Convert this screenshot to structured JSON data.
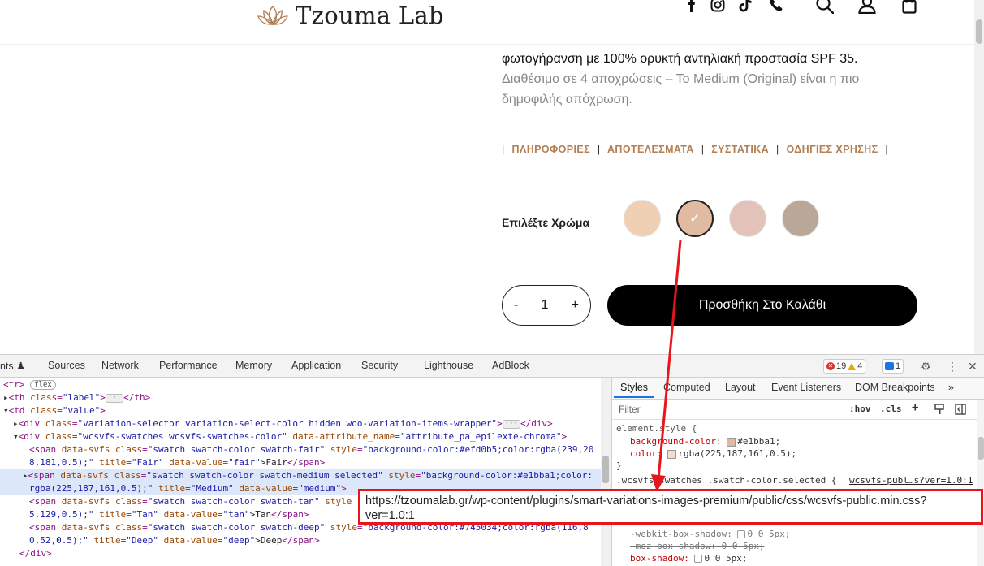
{
  "site": {
    "logo_text": "Tzouma Lab",
    "description_line1": "φωτογήρανση με 100% ορυκτή αντηλιακή προστασία SPF 35.",
    "description_line2": "Διαθέσιμο σε 4 αποχρώσεις – Το Medium (Original) είναι η πιο",
    "description_line3": "δημοφιλής απόχρωση.",
    "tabs": [
      "ΠΛΗΡΟΦΟΡΙΕΣ",
      "ΑΠΟΤΕΛΕΣΜΑΤΑ",
      "ΣΥΣΤΑΤΙΚΑ",
      "ΟΔΗΓΙΕΣ ΧΡΗΣΗΣ"
    ],
    "tab_separator": "|",
    "color_label": "Επιλέξτε Χρώμα",
    "swatches": [
      {
        "color": "#efd0b5",
        "selected": false
      },
      {
        "color": "#e1bba1",
        "selected": true
      },
      {
        "color": "#e3c2b9",
        "selected": false
      },
      {
        "color": "#b9a898",
        "selected": false
      }
    ],
    "check_glyph": "✓",
    "qty_minus": "-",
    "qty_value": "1",
    "qty_plus": "+",
    "add_to_cart": "Προσθήκη Στο Καλάθι",
    "header_icons": [
      "facebook-icon",
      "instagram-icon",
      "tiktok-icon",
      "phone-icon",
      "search-icon",
      "user-icon",
      "bag-icon"
    ]
  },
  "devtools": {
    "tabs": [
      "nts",
      "Sources",
      "Network",
      "Performance",
      "Memory",
      "Application",
      "Security",
      "Lighthouse",
      "AdBlock"
    ],
    "errors": "19",
    "warnings": "4",
    "infos": "1",
    "elements": {
      "l0_tag": "<tr>",
      "l0_badge": "flex",
      "l1_open": "<th ",
      "l1_attr": "class",
      "l1_val": "\"label\"",
      "l1_close": "</th>",
      "l2_open": "<td ",
      "l2_attr": "class",
      "l2_val": "\"value\"",
      "l3_open": "<div ",
      "l3_attr": "class",
      "l3_val": "\"variation-selector variation-select-color hidden woo-variation-items-wrapper\"",
      "l3_close": "</div>",
      "l4_open": "<div ",
      "l4_attr1": "class",
      "l4_val1": "\"wcsvfs-swatches wcsvfs-swatches-color\"",
      "l4_attr2": "data-attribute_name",
      "l4_val2": "\"attribute_pa_epilexte-chroma\"",
      "l5_a": "<span ",
      "l5_b": "data-svfs ",
      "l5_c": "class",
      "l5_d": "\"swatch swatch-color swatch-fair\" ",
      "l5_e": "style",
      "l5_f": "\"background-color:#efd0b5;color:rgba(239,20",
      "l6_a": "8,181,0.5);\" ",
      "l6_b": "title",
      "l6_c": "\"Fair\" ",
      "l6_d": "data-value",
      "l6_e": "\"fair\"",
      "l6_f": ">Fair",
      "l6_g": "</span>",
      "l7_a": "<span ",
      "l7_b": "data-svfs ",
      "l7_c": "class",
      "l7_d": "\"swatch swatch-color swatch-medium selected\" ",
      "l7_e": "style",
      "l7_f": "\"background-color:#e1bba1;color:",
      "l8_a": "rgba(225,187,161,0.5);\" ",
      "l8_b": "title",
      "l8_c": "\"Medium\" ",
      "l8_d": "data-value",
      "l8_e": "\"medium\"",
      "l8_f": ">",
      "l9_a": "<span ",
      "l9_b": "data-svfs ",
      "l9_c": "class",
      "l9_d": "\"swatch swatch-color swatch-tan\" ",
      "l9_e": "style",
      "l10_a": "5,129,0.5);\" ",
      "l10_b": "title",
      "l10_c": "\"Tan\" ",
      "l10_d": "data-value",
      "l10_e": "\"tan\"",
      "l10_f": ">Tan",
      "l10_g": "</span>",
      "l11_a": "<span ",
      "l11_b": "data-svfs ",
      "l11_c": "class",
      "l11_d": "\"swatch swatch-color swatch-deep\" ",
      "l11_e": "style",
      "l11_f": "\"background-color:#745034;color:rgba(116,8",
      "l12_a": "0,52,0.5);\" ",
      "l12_b": "title",
      "l12_c": "\"Deep\" ",
      "l12_d": "data-value",
      "l12_e": "\"deep\"",
      "l12_f": ">Deep",
      "l12_g": "</span>",
      "l13": "</div>",
      "equals": "="
    },
    "styles": {
      "tabs": [
        "Styles",
        "Computed",
        "Layout",
        "Event Listeners",
        "DOM Breakpoints"
      ],
      "more": "»",
      "filter_placeholder": "Filter",
      "hov": ":hov",
      "cls": ".cls",
      "plus": "+",
      "element_style": "element.style {",
      "bg_prop": "background-color",
      "bg_val": "#e1bba1;",
      "color_prop": "color",
      "color_val": "rgba(225,187,161,0.5);",
      "close_brace": "}",
      "rule_selector": ".wcsvfs-swatches .swatch-color.selected {",
      "rule_link": "wcsvfs-publ…s?ver=1.0:1",
      "webkit_shadow": "-webkit-box-shadow: ",
      "webkit_val": "0 0 5px;",
      "moz_shadow": "-moz-box-shadow: 0 0 5px;",
      "box_shadow": "box-shadow: ",
      "box_shadow_val": "0 0 5px;"
    }
  },
  "tooltip": {
    "line1": "https://tzoumalab.gr/wp-content/plugins/smart-variations-images-premium/public/css/wcsvfs-public.min.css?",
    "line2": "ver=1.0:1"
  },
  "colors": {
    "annotation_red": "#e8151b",
    "tab_accent": "#b37f55"
  }
}
